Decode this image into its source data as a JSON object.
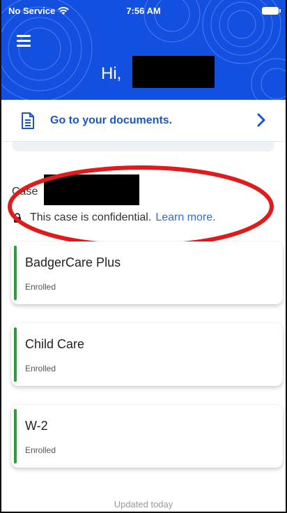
{
  "status_bar": {
    "carrier": "No Service",
    "time": "7:56 AM"
  },
  "header": {
    "greeting": "Hi,",
    "background_color": "#1450e0"
  },
  "documents_link": {
    "label": "Go to your documents.",
    "icon": "document-icon",
    "chevron": "chevron-right-icon"
  },
  "case": {
    "label": "Case",
    "confidential_text": "This case is confidential.",
    "learn_more": "Learn more."
  },
  "programs": [
    {
      "name": "BadgerCare Plus",
      "status": "Enrolled"
    },
    {
      "name": "Child Care",
      "status": "Enrolled"
    },
    {
      "name": "W-2",
      "status": "Enrolled"
    }
  ],
  "footer": {
    "updated": "Updated today"
  },
  "colors": {
    "accent_green": "#2e9c3a",
    "link_blue": "#1a54c8",
    "highlight_red": "#e01b1b"
  }
}
